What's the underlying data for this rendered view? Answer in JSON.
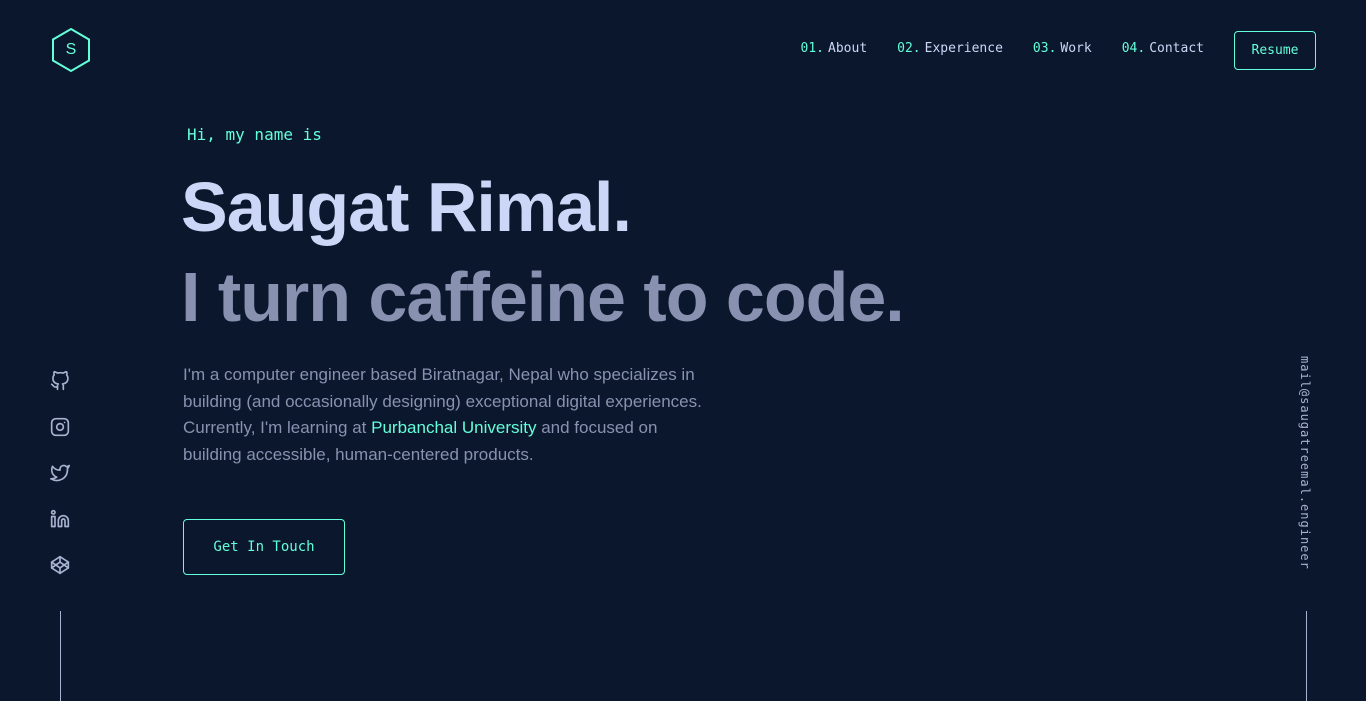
{
  "header": {
    "logo_letter": "S",
    "nav": [
      {
        "num": "01.",
        "label": "About"
      },
      {
        "num": "02.",
        "label": "Experience"
      },
      {
        "num": "03.",
        "label": "Work"
      },
      {
        "num": "04.",
        "label": "Contact"
      }
    ],
    "resume_label": "Resume"
  },
  "hero": {
    "greeting": "Hi, my name is",
    "name": "Saugat Rimal.",
    "tagline": "I turn caffeine to code.",
    "bio_before": "I'm a computer engineer based Biratnagar, Nepal who specializes in building (and occasionally designing) exceptional digital experiences. Currently, I'm learning at ",
    "bio_link": "Purbanchal University",
    "bio_after": " and focused on building accessible, human-centered products.",
    "cta_label": "Get In Touch"
  },
  "social": {
    "icons": [
      "github-icon",
      "instagram-icon",
      "twitter-icon",
      "linkedin-icon",
      "codepen-icon"
    ]
  },
  "email": "mail@saugatreemal.engineer",
  "colors": {
    "background": "#0b172c",
    "accent": "#64ffda",
    "heading": "#ccd6f6",
    "text": "#8892b0"
  }
}
